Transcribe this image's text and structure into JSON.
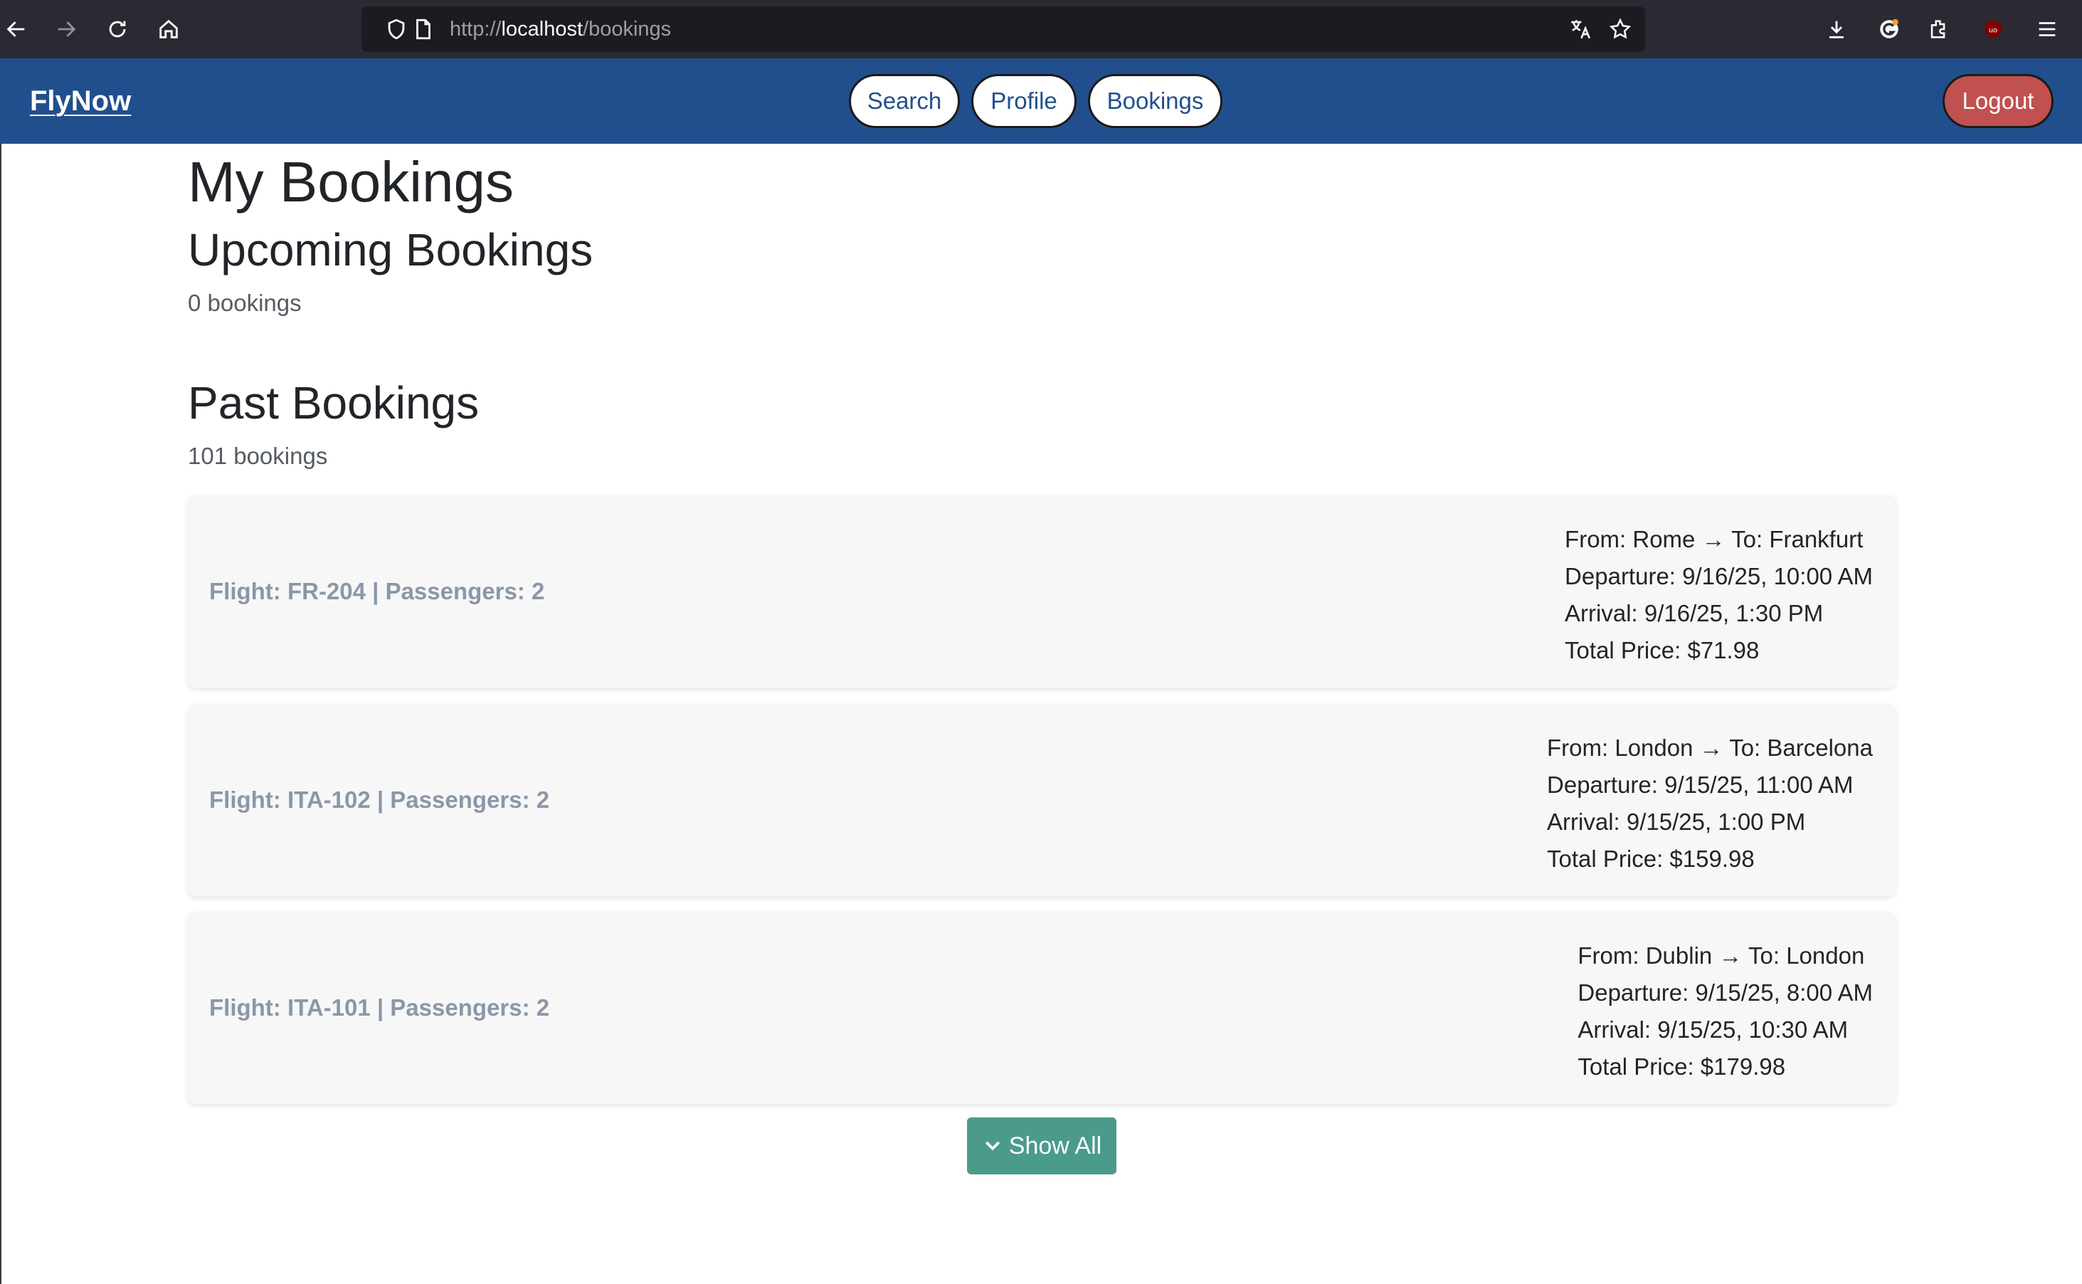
{
  "browser": {
    "url_scheme": "http://",
    "url_host": "localhost",
    "url_path": "/bookings"
  },
  "nav": {
    "brand": "FlyNow",
    "links": [
      {
        "label": "Search"
      },
      {
        "label": "Profile"
      },
      {
        "label": "Bookings"
      }
    ],
    "logout": "Logout"
  },
  "page": {
    "title": "My Bookings",
    "upcoming": {
      "heading": "Upcoming Bookings",
      "count": "0 bookings"
    },
    "past": {
      "heading": "Past Bookings",
      "count": "101 bookings",
      "items": [
        {
          "title": "Flight: FR-204 | Passengers: 2",
          "route": "From: Rome → To: Frankfurt",
          "departure": "Departure: 9/16/25, 10:00 AM",
          "arrival": "Arrival: 9/16/25, 1:30 PM",
          "price": "Total Price: $71.98"
        },
        {
          "title": "Flight: ITA-102 | Passengers: 2",
          "route": "From: London → To: Barcelona",
          "departure": "Departure: 9/15/25, 11:00 AM",
          "arrival": "Arrival: 9/15/25, 1:00 PM",
          "price": "Total Price: $159.98"
        },
        {
          "title": "Flight: ITA-101 | Passengers: 2",
          "route": "From: Dublin → To: London",
          "departure": "Departure: 9/15/25, 8:00 AM",
          "arrival": "Arrival: 9/15/25, 10:30 AM",
          "price": "Total Price: $179.98"
        }
      ]
    },
    "show_all": "Show All"
  },
  "colors": {
    "nav_bg": "#214f8d",
    "logout_bg": "#c0514f",
    "show_all_bg": "#4a9b8a",
    "card_title": "#8a97a8"
  }
}
